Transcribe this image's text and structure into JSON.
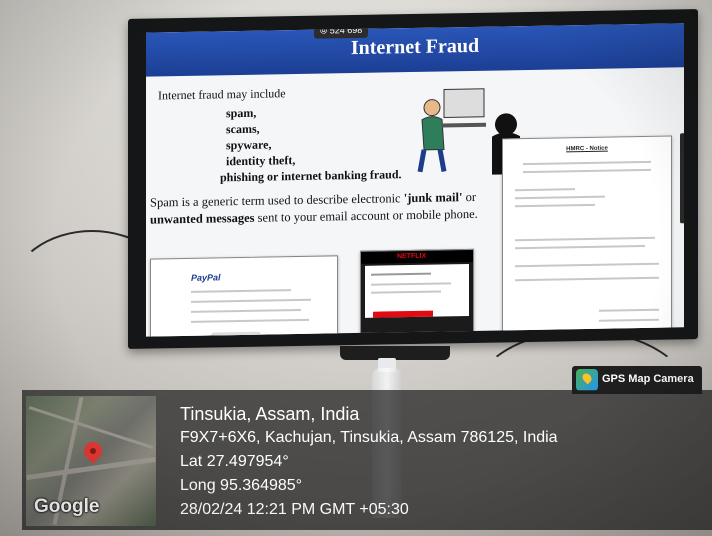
{
  "slide": {
    "counter": "⦾ 524 698",
    "title": "Internet Fraud",
    "intro": "Internet fraud may include",
    "items": [
      "spam,",
      "scams,",
      "spyware,",
      "identity theft,",
      "phishing or internet banking fraud."
    ],
    "spam_pre": "Spam is a generic term used to describe electronic ",
    "spam_bold1": "'junk mail'",
    "spam_mid": " or ",
    "spam_bold2": "unwanted messages",
    "spam_post": " sent to your email account or mobile phone."
  },
  "cards": {
    "paypal_logo": "PayPal",
    "netflix_logo": "NETFLIX",
    "hmrc_title": "HMRC - Notice"
  },
  "badge": {
    "label": "GPS Map Camera",
    "icon": "map-pin-icon"
  },
  "location": {
    "place": "Tinsukia, Assam, India",
    "address": "F9X7+6X6, Kachujan, Tinsukia, Assam 786125, India",
    "lat": "Lat 27.497954°",
    "long": "Long 95.364985°",
    "datetime": "28/02/24 12:21 PM GMT +05:30"
  },
  "map": {
    "brand": "Google",
    "pin_color": "#e53935"
  },
  "colors": {
    "slide_header": "#1c3f95",
    "netflix_red": "#e50914"
  }
}
